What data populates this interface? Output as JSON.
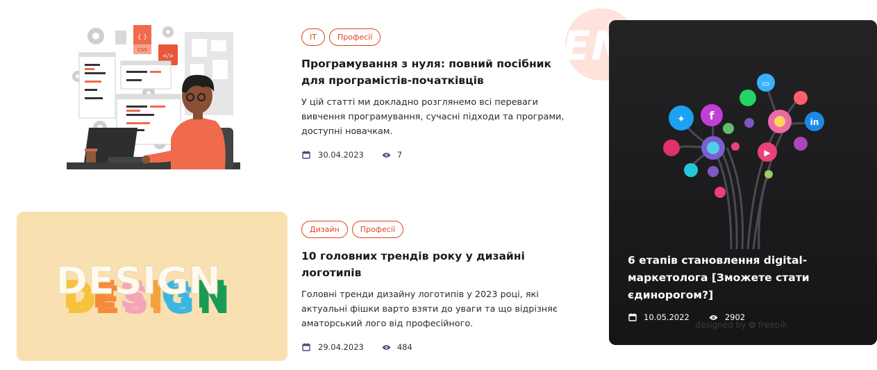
{
  "articles": [
    {
      "tags": [
        "IT",
        "Професії"
      ],
      "title": "Програмування з нуля: повний посібник для програмістів-початківців",
      "excerpt": "У цій статті ми докладно розглянемо всі переваги вивчення програмування, сучасні підходи та програми, доступні новачкам.",
      "date": "30.04.2023",
      "views": "7",
      "image": {
        "label_css": "CSS",
        "label_js": "{ }",
        "label_code": "</>"
      }
    },
    {
      "tags": [
        "Дизайн",
        "Професії"
      ],
      "title": "10 головних трендів року у дизайні логотипів",
      "excerpt": "Головні тренди дизайну логотипів у 2023 році, які актуальні фішки варто взяти до уваги та що відрізняє аматорський лого від професійного.",
      "date": "29.04.2023",
      "views": "484",
      "image": {
        "word": "DESIGN"
      }
    }
  ],
  "featured": {
    "title": "6 етапів становлення digital-маркетолога [Зможете стати єдинорогом?]",
    "date": "10.05.2022",
    "views": "2902",
    "credit": "designed by ✿ freepik"
  },
  "decoration": {
    "text": "EN"
  },
  "colors": {
    "accent": "#e3431b",
    "icon": "#5a3d7a",
    "dark_card": "#1b1b1d",
    "design_bg": "#f9e0b1"
  },
  "icons": [
    "calendar-icon",
    "eye-icon"
  ]
}
